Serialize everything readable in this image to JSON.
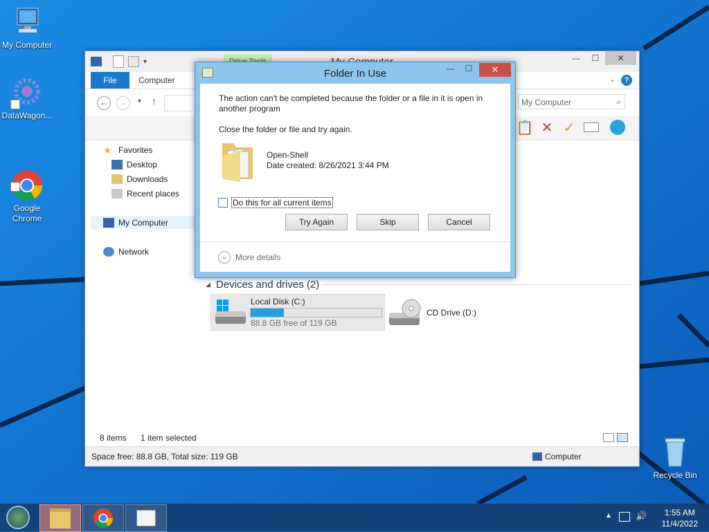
{
  "desktop": {
    "icons": [
      {
        "label": "My Computer"
      },
      {
        "label": "DataWagon..."
      },
      {
        "label": "Google\nChrome"
      },
      {
        "label": "Recycle Bin"
      }
    ]
  },
  "explorer": {
    "title": "My Computer",
    "contextual_tab": "Drive Tools",
    "ribbon": {
      "file_tab": "File",
      "computer_tab": "Computer"
    },
    "search_placeholder": "My Computer",
    "nav": {
      "favorites": "Favorites",
      "desktop": "Desktop",
      "downloads": "Downloads",
      "recent": "Recent places",
      "my_computer": "My Computer",
      "network": "Network"
    },
    "group_title": "Devices and drives (2)",
    "drives": [
      {
        "name": "Local Disk (C:)",
        "free_text": "88.8 GB free of 119 GB",
        "used_fraction": 0.254
      },
      {
        "name": "CD Drive (D:)"
      }
    ],
    "status": {
      "item_count": "8 items",
      "selected": "1 item selected",
      "space": "Space free: 88.8 GB, Total size: 119 GB",
      "location": "Computer"
    }
  },
  "dialog": {
    "title": "Folder In Use",
    "message": "The action can't be completed because the folder or a file in it is open in another program",
    "instruction": "Close the folder or file and try again.",
    "item_name": "Open-Shell",
    "item_date": "Date created: 8/26/2021 3:44 PM",
    "checkbox_label": "Do this for all current items",
    "buttons": {
      "try_again": "Try Again",
      "skip": "Skip",
      "cancel": "Cancel"
    },
    "more_details": "More details"
  },
  "taskbar": {
    "time": "1:55 AM",
    "date": "11/4/2022"
  },
  "colors": {
    "accent": "#1979ca",
    "desktop_bg": "#0d6fd0",
    "dialog_frame": "#8ec5ec",
    "close_red": "#c7504b"
  }
}
